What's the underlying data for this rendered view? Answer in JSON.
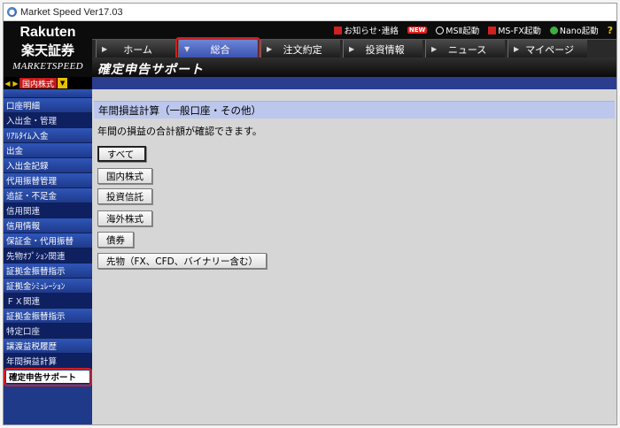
{
  "window": {
    "title": "Market Speed Ver17.03"
  },
  "brand": {
    "rakuten": "Rakuten",
    "kanji": "楽天証券",
    "product": "MARKETSPEED"
  },
  "toolbar": [
    {
      "label": "お知らせ･連絡",
      "icon": "notice-icon",
      "color": "#d02020"
    },
    {
      "label": "NEW",
      "icon": "new-badge"
    },
    {
      "label": "MSⅡ起動",
      "icon": "ms2-icon",
      "color": "#ffffff"
    },
    {
      "label": "MS-FX起動",
      "icon": "msfx-icon",
      "color": "#d02020"
    },
    {
      "label": "Nano起動",
      "icon": "nano-icon",
      "color": "#3fae3f"
    },
    {
      "label": "?",
      "icon": "help-icon"
    }
  ],
  "nav": {
    "tabs": [
      {
        "label": "ホーム"
      },
      {
        "label": "総合",
        "active": true
      },
      {
        "label": "注文約定"
      },
      {
        "label": "投資情報"
      },
      {
        "label": "ニュース"
      },
      {
        "label": "マイページ"
      }
    ]
  },
  "banner": {
    "title": "確定申告サポート"
  },
  "market": {
    "selected": "国内株式"
  },
  "sidebar": {
    "items": [
      {
        "label": "口座明細",
        "type": "item"
      },
      {
        "label": "入出金・管理",
        "type": "header"
      },
      {
        "label": "ﾘｱﾙﾀｲﾑ入金",
        "type": "item"
      },
      {
        "label": "出金",
        "type": "item"
      },
      {
        "label": "入出金記録",
        "type": "item"
      },
      {
        "label": "代用振替管理",
        "type": "item"
      },
      {
        "label": "追証・不足金",
        "type": "item"
      },
      {
        "label": "信用関連",
        "type": "header"
      },
      {
        "label": "信用情報",
        "type": "item"
      },
      {
        "label": "保証金・代用振替",
        "type": "item"
      },
      {
        "label": "先物ｵﾌﾟｼｮﾝ関連",
        "type": "header"
      },
      {
        "label": "証拠金振替指示",
        "type": "item"
      },
      {
        "label": "証拠金ｼﾐｭﾚｰｼｮﾝ",
        "type": "item"
      },
      {
        "label": "ＦＸ関連",
        "type": "header"
      },
      {
        "label": "証拠金振替指示",
        "type": "item"
      },
      {
        "label": "特定口座",
        "type": "header"
      },
      {
        "label": "譲渡益税履歴",
        "type": "item"
      },
      {
        "label": "年間損益計算",
        "type": "header"
      },
      {
        "label": "確定申告サポート",
        "type": "current"
      }
    ]
  },
  "main": {
    "section_title": "年間損益計算（一般口座・その他）",
    "description": "年間の損益の合計額が確認できます。",
    "buttons": [
      {
        "label": "すべて",
        "selected": true
      },
      {
        "label": "国内株式"
      },
      {
        "label": "投資信託"
      },
      {
        "label": "海外株式"
      },
      {
        "label": "債券"
      },
      {
        "label": "先物（FX、CFD、バイナリー含む）"
      }
    ]
  }
}
